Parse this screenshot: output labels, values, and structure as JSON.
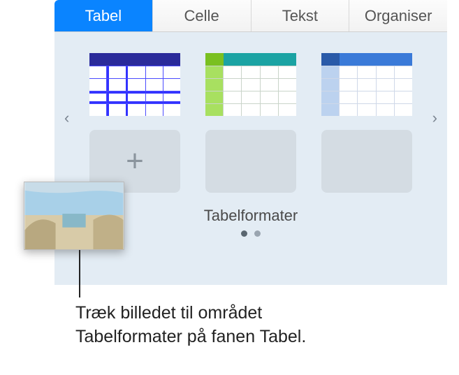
{
  "tabs": {
    "tabel": "Tabel",
    "celle": "Celle",
    "tekst": "Tekst",
    "organiser": "Organiser"
  },
  "section": {
    "label": "Tabelformater",
    "add_glyph": "+"
  },
  "nav": {
    "left": "‹",
    "right": "›"
  },
  "callout": {
    "line1": "Træk billedet til området",
    "line2": "Tabelformater på fanen Tabel."
  }
}
